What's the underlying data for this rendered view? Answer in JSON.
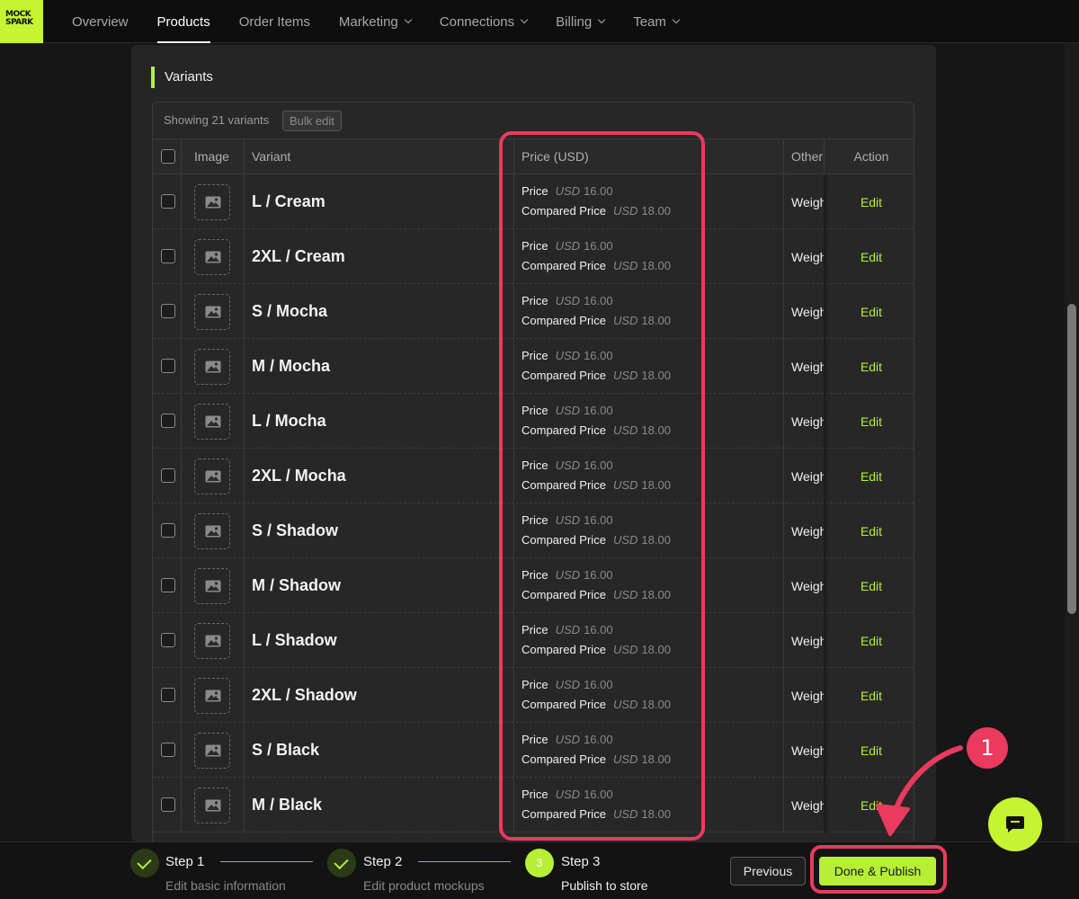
{
  "logo": {
    "line1": "MOCK",
    "line2": "SPARK"
  },
  "nav": {
    "items": [
      {
        "label": "Overview",
        "dropdown": false,
        "active": false
      },
      {
        "label": "Products",
        "dropdown": false,
        "active": true
      },
      {
        "label": "Order Items",
        "dropdown": false,
        "active": false
      },
      {
        "label": "Marketing",
        "dropdown": true,
        "active": false
      },
      {
        "label": "Connections",
        "dropdown": true,
        "active": false
      },
      {
        "label": "Billing",
        "dropdown": true,
        "active": false
      },
      {
        "label": "Team",
        "dropdown": true,
        "active": false
      }
    ]
  },
  "section": {
    "title": "Variants"
  },
  "table": {
    "showing_text": "Showing 21 variants",
    "bulk_edit_label": "Bulk edit",
    "headers": {
      "image": "Image",
      "variant": "Variant",
      "price": "Price (USD)",
      "other": "Other",
      "action": "Action"
    },
    "price_label": "Price",
    "compared_label": "Compared Price",
    "currency": "USD",
    "other_text": "Weight",
    "edit_label": "Edit",
    "rows": [
      {
        "variant": "L / Cream",
        "price": "16.00",
        "compared_price": "18.00"
      },
      {
        "variant": "2XL / Cream",
        "price": "16.00",
        "compared_price": "18.00"
      },
      {
        "variant": "S / Mocha",
        "price": "16.00",
        "compared_price": "18.00"
      },
      {
        "variant": "M / Mocha",
        "price": "16.00",
        "compared_price": "18.00"
      },
      {
        "variant": "L / Mocha",
        "price": "16.00",
        "compared_price": "18.00"
      },
      {
        "variant": "2XL / Mocha",
        "price": "16.00",
        "compared_price": "18.00"
      },
      {
        "variant": "S / Shadow",
        "price": "16.00",
        "compared_price": "18.00"
      },
      {
        "variant": "M / Shadow",
        "price": "16.00",
        "compared_price": "18.00"
      },
      {
        "variant": "L / Shadow",
        "price": "16.00",
        "compared_price": "18.00"
      },
      {
        "variant": "2XL / Shadow",
        "price": "16.00",
        "compared_price": "18.00"
      },
      {
        "variant": "S / Black",
        "price": "16.00",
        "compared_price": "18.00"
      },
      {
        "variant": "M / Black",
        "price": "16.00",
        "compared_price": "18.00"
      }
    ]
  },
  "steps": [
    {
      "number": "1",
      "title": "Step 1",
      "description": "Edit basic information",
      "state": "done"
    },
    {
      "number": "2",
      "title": "Step 2",
      "description": "Edit product mockups",
      "state": "done"
    },
    {
      "number": "3",
      "title": "Step 3",
      "description": "Publish to store",
      "state": "current"
    }
  ],
  "footer": {
    "previous_label": "Previous",
    "publish_label": "Done & Publish"
  },
  "annotation": {
    "badge_number": "1"
  },
  "colors": {
    "accent": "#b6ef35",
    "highlight": "#ea3a5e",
    "background": "#161616",
    "panel": "#252525"
  },
  "icons": {
    "chat": "chat-bubble-icon",
    "image_placeholder": "image-placeholder-icon",
    "check": "check-icon"
  }
}
